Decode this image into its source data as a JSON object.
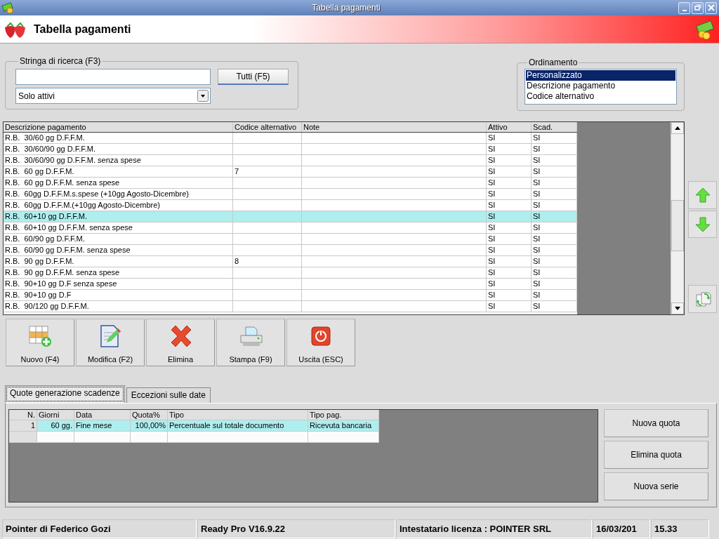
{
  "window": {
    "title": "Tabella pagamenti"
  },
  "header": {
    "title": "Tabella pagamenti"
  },
  "search": {
    "legend": "Stringa di ricerca (F3)",
    "button": "Tutti (F5)",
    "filter": "Solo attivi"
  },
  "sorting": {
    "legend": "Ordinamento",
    "options": [
      {
        "label": "Personalizzato",
        "selected": true
      },
      {
        "label": "Descrizione pagamento",
        "selected": false
      },
      {
        "label": "Codice alternativo",
        "selected": false
      }
    ]
  },
  "table": {
    "columns": [
      "Descrizione pagamento",
      "Codice alternativo",
      "Note",
      "Attivo",
      "Scad."
    ],
    "rows": [
      {
        "description": "R.B.  30/60 gg D.F.F.M.",
        "active": "SI",
        "due": "SI",
        "selected": false
      },
      {
        "description": "R.B.  30/60/90 gg D.F.F.M.",
        "active": "SI",
        "due": "SI",
        "selected": false
      },
      {
        "description": "R.B.  30/60/90 gg D.F.F.M. senza spese",
        "active": "SI",
        "due": "SI",
        "selected": false
      },
      {
        "description": "R.B.  60 gg D.F.F.M.",
        "code": "7",
        "active": "SI",
        "due": "SI",
        "selected": false
      },
      {
        "description": "R.B.  60 gg D.F.F.M. senza spese",
        "active": "SI",
        "due": "SI",
        "selected": false
      },
      {
        "description": "R.B.  60gg D.F.F.M.s.spese (+10gg Agosto-Dicembre)",
        "active": "SI",
        "due": "SI",
        "selected": false
      },
      {
        "description": "R.B.  60gg D.F.F.M.(+10gg Agosto-Dicembre)",
        "active": "SI",
        "due": "SI",
        "selected": false
      },
      {
        "description": "R.B.  60+10 gg D.F.F.M.",
        "active": "SI",
        "due": "SI",
        "selected": true
      },
      {
        "description": "R.B.  60+10 gg D.F.F.M. senza spese",
        "active": "SI",
        "due": "SI",
        "selected": false
      },
      {
        "description": "R.B.  60/90 gg D.F.F.M.",
        "active": "SI",
        "due": "SI",
        "selected": false
      },
      {
        "description": "R.B.  60/90 gg D.F.F.M. senza spese",
        "active": "SI",
        "due": "SI",
        "selected": false
      },
      {
        "description": "R.B.  90 gg D.F.F.M.",
        "code": "8",
        "active": "SI",
        "due": "SI",
        "selected": false
      },
      {
        "description": "R.B.  90 gg D.F.F.M. senza spese",
        "active": "SI",
        "due": "SI",
        "selected": false
      },
      {
        "description": "R.B.  90+10 gg D.F senza spese",
        "active": "SI",
        "due": "SI",
        "selected": false
      },
      {
        "description": "R.B.  90+10 gg D.F",
        "active": "SI",
        "due": "SI",
        "selected": false
      },
      {
        "description": "R.B.  90/120 gg D.F.F.M.",
        "active": "SI",
        "due": "SI",
        "selected": false
      }
    ]
  },
  "toolbar": [
    {
      "label": "Nuovo (F4)",
      "kind": "new"
    },
    {
      "label": "Modifica (F2)",
      "kind": "edit"
    },
    {
      "label": "Elimina",
      "kind": "delete"
    },
    {
      "label": "Stampa (F9)",
      "kind": "print"
    },
    {
      "label": "Uscita (ESC)",
      "kind": "exit"
    }
  ],
  "tabs": [
    {
      "label": "Quote generazione scadenze",
      "selected": true
    },
    {
      "label": "Eccezioni sulle date",
      "selected": false
    }
  ],
  "quote_table": {
    "columns": [
      "N.",
      "Giorni",
      "Data",
      "Quota%",
      "Tipo",
      "Tipo pag."
    ],
    "rows": [
      {
        "n": "1",
        "days": "60 gg.",
        "date": "Fine mese",
        "share": "100,00%",
        "type": "Percentuale sul totale documento",
        "payment_type": "Ricevuta bancaria",
        "selected": true
      }
    ]
  },
  "quote_buttons": [
    "Nuova quota",
    "Elimina quota",
    "Nuova serie"
  ],
  "status_bar": [
    "Pointer di Federico Gozi",
    "Ready Pro V16.9.22",
    "Intestatario licenza : POINTER SRL",
    "16/03/201",
    "15.33"
  ]
}
